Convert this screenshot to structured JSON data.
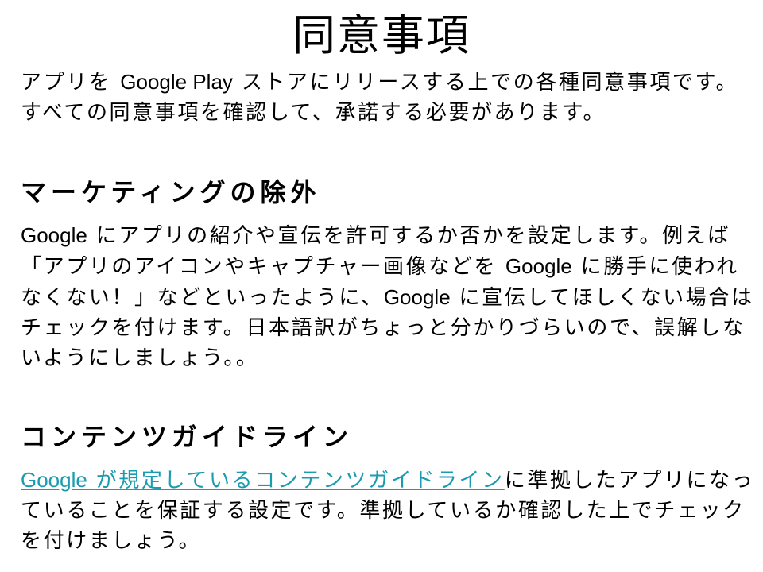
{
  "slide": {
    "title": "同意事項",
    "intro": {
      "part1": "アプリを",
      "part2": "Google Play",
      "part3": "ストアにリリースする上での各種同意事項です。すべての同意事項を確認して、承諾する必要があります。"
    },
    "marketing": {
      "heading": "マーケティングの除外",
      "p1": "Google",
      "p2": "にアプリの紹介や宣伝を許可するか否かを設定します。例えば「アプリのアイコンやキャプチャー画像などを",
      "p3": "Google",
      "p4": "に勝手に使われなくない！」などといったように、",
      "p5": "Google",
      "p6": "に宣伝してほしくない場合はチェックを付けます。日本語訳がちょっと分かりづらいので、誤解しないようにしましょう。。"
    },
    "content": {
      "heading": "コンテンツガイドライン",
      "link_en": "Google",
      "link_ja": "が規定しているコンテンツガイドライン",
      "rest": "に準拠したアプリになっていることを保証する設定です。準拠しているか確認した上でチェックを付けましょう。"
    }
  },
  "colors": {
    "text": "#000000",
    "link": "#1a9bb0",
    "background": "#ffffff"
  }
}
